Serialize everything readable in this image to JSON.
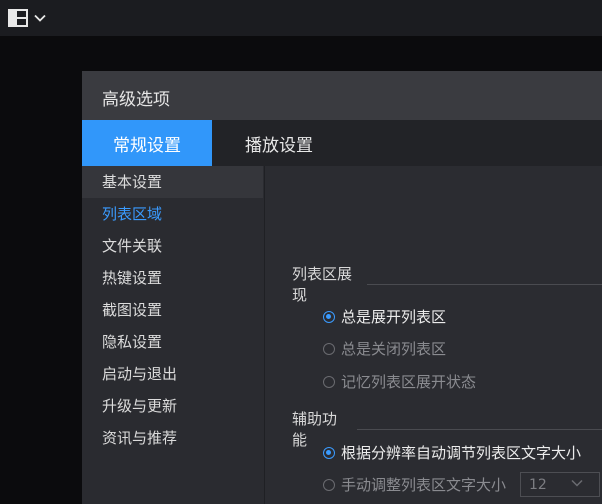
{
  "topbar": {
    "icon": "layout-icon",
    "dropdown_icon": "chevron-down-icon"
  },
  "dialog": {
    "title": "高级选项",
    "tabs": [
      {
        "label": "常规设置",
        "active": true
      },
      {
        "label": "播放设置",
        "active": false
      }
    ],
    "sidebar": {
      "items": [
        {
          "label": "基本设置",
          "state": "hover"
        },
        {
          "label": "列表区域",
          "state": "selected"
        },
        {
          "label": "文件关联",
          "state": ""
        },
        {
          "label": "热键设置",
          "state": ""
        },
        {
          "label": "截图设置",
          "state": ""
        },
        {
          "label": "隐私设置",
          "state": ""
        },
        {
          "label": "启动与退出",
          "state": ""
        },
        {
          "label": "升级与更新",
          "state": ""
        },
        {
          "label": "资讯与推荐",
          "state": ""
        }
      ]
    },
    "list_display": {
      "title": "列表区展现",
      "options": [
        {
          "label": "总是展开列表区",
          "checked": true
        },
        {
          "label": "总是关闭列表区",
          "checked": false
        },
        {
          "label": "记忆列表区展开状态",
          "checked": false
        }
      ]
    },
    "assist": {
      "title": "辅助功能",
      "options": [
        {
          "label": "根据分辨率自动调节列表区文字大小",
          "checked": true
        },
        {
          "label": "手动调整列表区文字大小",
          "checked": false
        }
      ],
      "font_size_value": "12"
    }
  },
  "colors": {
    "accent": "#3197fa",
    "selected_text": "#3a9bff"
  }
}
